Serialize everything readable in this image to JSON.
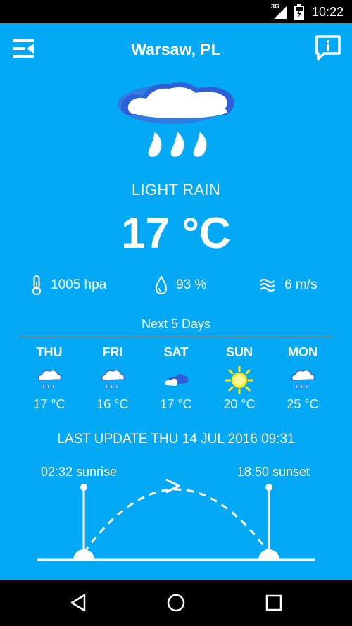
{
  "status": {
    "network": "3G",
    "time": "10:22"
  },
  "header": {
    "city": "Warsaw, PL"
  },
  "current": {
    "description": "LIGHT RAIN",
    "temperature": "17 °C",
    "pressure": "1005 hpa",
    "humidity": "93 %",
    "wind": "6 m/s",
    "icon": "cloud-rain-icon"
  },
  "forecast": {
    "title": "Next 5 Days",
    "days": [
      {
        "name": "THU",
        "temp": "17 °C",
        "icon": "rain-icon"
      },
      {
        "name": "FRI",
        "temp": "16 °C",
        "icon": "rain-icon"
      },
      {
        "name": "SAT",
        "temp": "17 °C",
        "icon": "cloudy-icon"
      },
      {
        "name": "SUN",
        "temp": "20 °C",
        "icon": "sun-icon"
      },
      {
        "name": "MON",
        "temp": "25 °C",
        "icon": "rain-icon"
      }
    ]
  },
  "last_update": "LAST UPDATE THU 14 JUL 2016 09:31",
  "sun": {
    "sunrise": "02:32 sunrise",
    "sunset": "18:50 sunset"
  },
  "colors": {
    "background": "#03A9F4",
    "text": "#FFFFFF",
    "sun_yellow": "#FFE81A"
  }
}
